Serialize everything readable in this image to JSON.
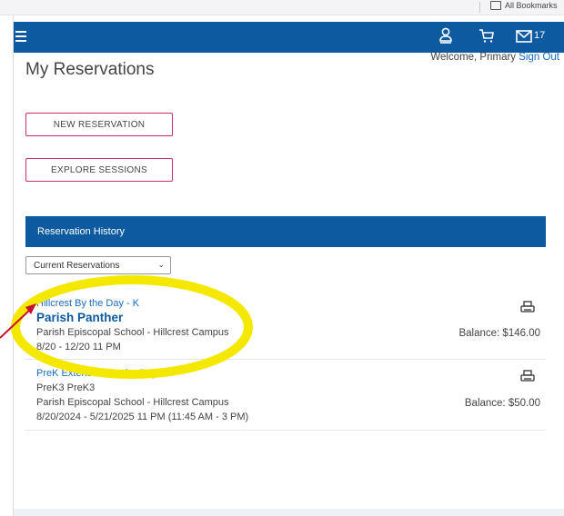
{
  "browser": {
    "bookmarks_label": "All Bookmarks"
  },
  "nav": {
    "message_count": "17"
  },
  "welcome": {
    "text": "Welcome, Primary",
    "signout": "Sign Out"
  },
  "page": {
    "title": "My Reservations"
  },
  "buttons": {
    "new_reservation": "NEW RESERVATION",
    "explore_sessions": "EXPLORE SESSIONS"
  },
  "history": {
    "title": "Reservation History",
    "filter_value": "Current Reservations"
  },
  "reservations": [
    {
      "session": "Hillcrest By the Day - K",
      "student": "Parish Panther",
      "school": "Parish Episcopal School - Hillcrest Campus",
      "dates": "8/20 - 12/20 11 PM",
      "balance": "Balance: $146.00"
    },
    {
      "session": "PreK Extension By the Day",
      "student": "PreK3 PreK3",
      "school": "Parish Episcopal School - Hillcrest Campus",
      "dates": "8/20/2024 - 5/21/2025 11 PM (11:45 AM - 3 PM)",
      "balance": "Balance: $50.00"
    }
  ],
  "colors": {
    "nav_blue": "#0d5aa1",
    "button_border": "#c82e6a",
    "link_blue": "#1a6cc1",
    "highlight": "#f5e800",
    "arrow": "#c8102e"
  }
}
